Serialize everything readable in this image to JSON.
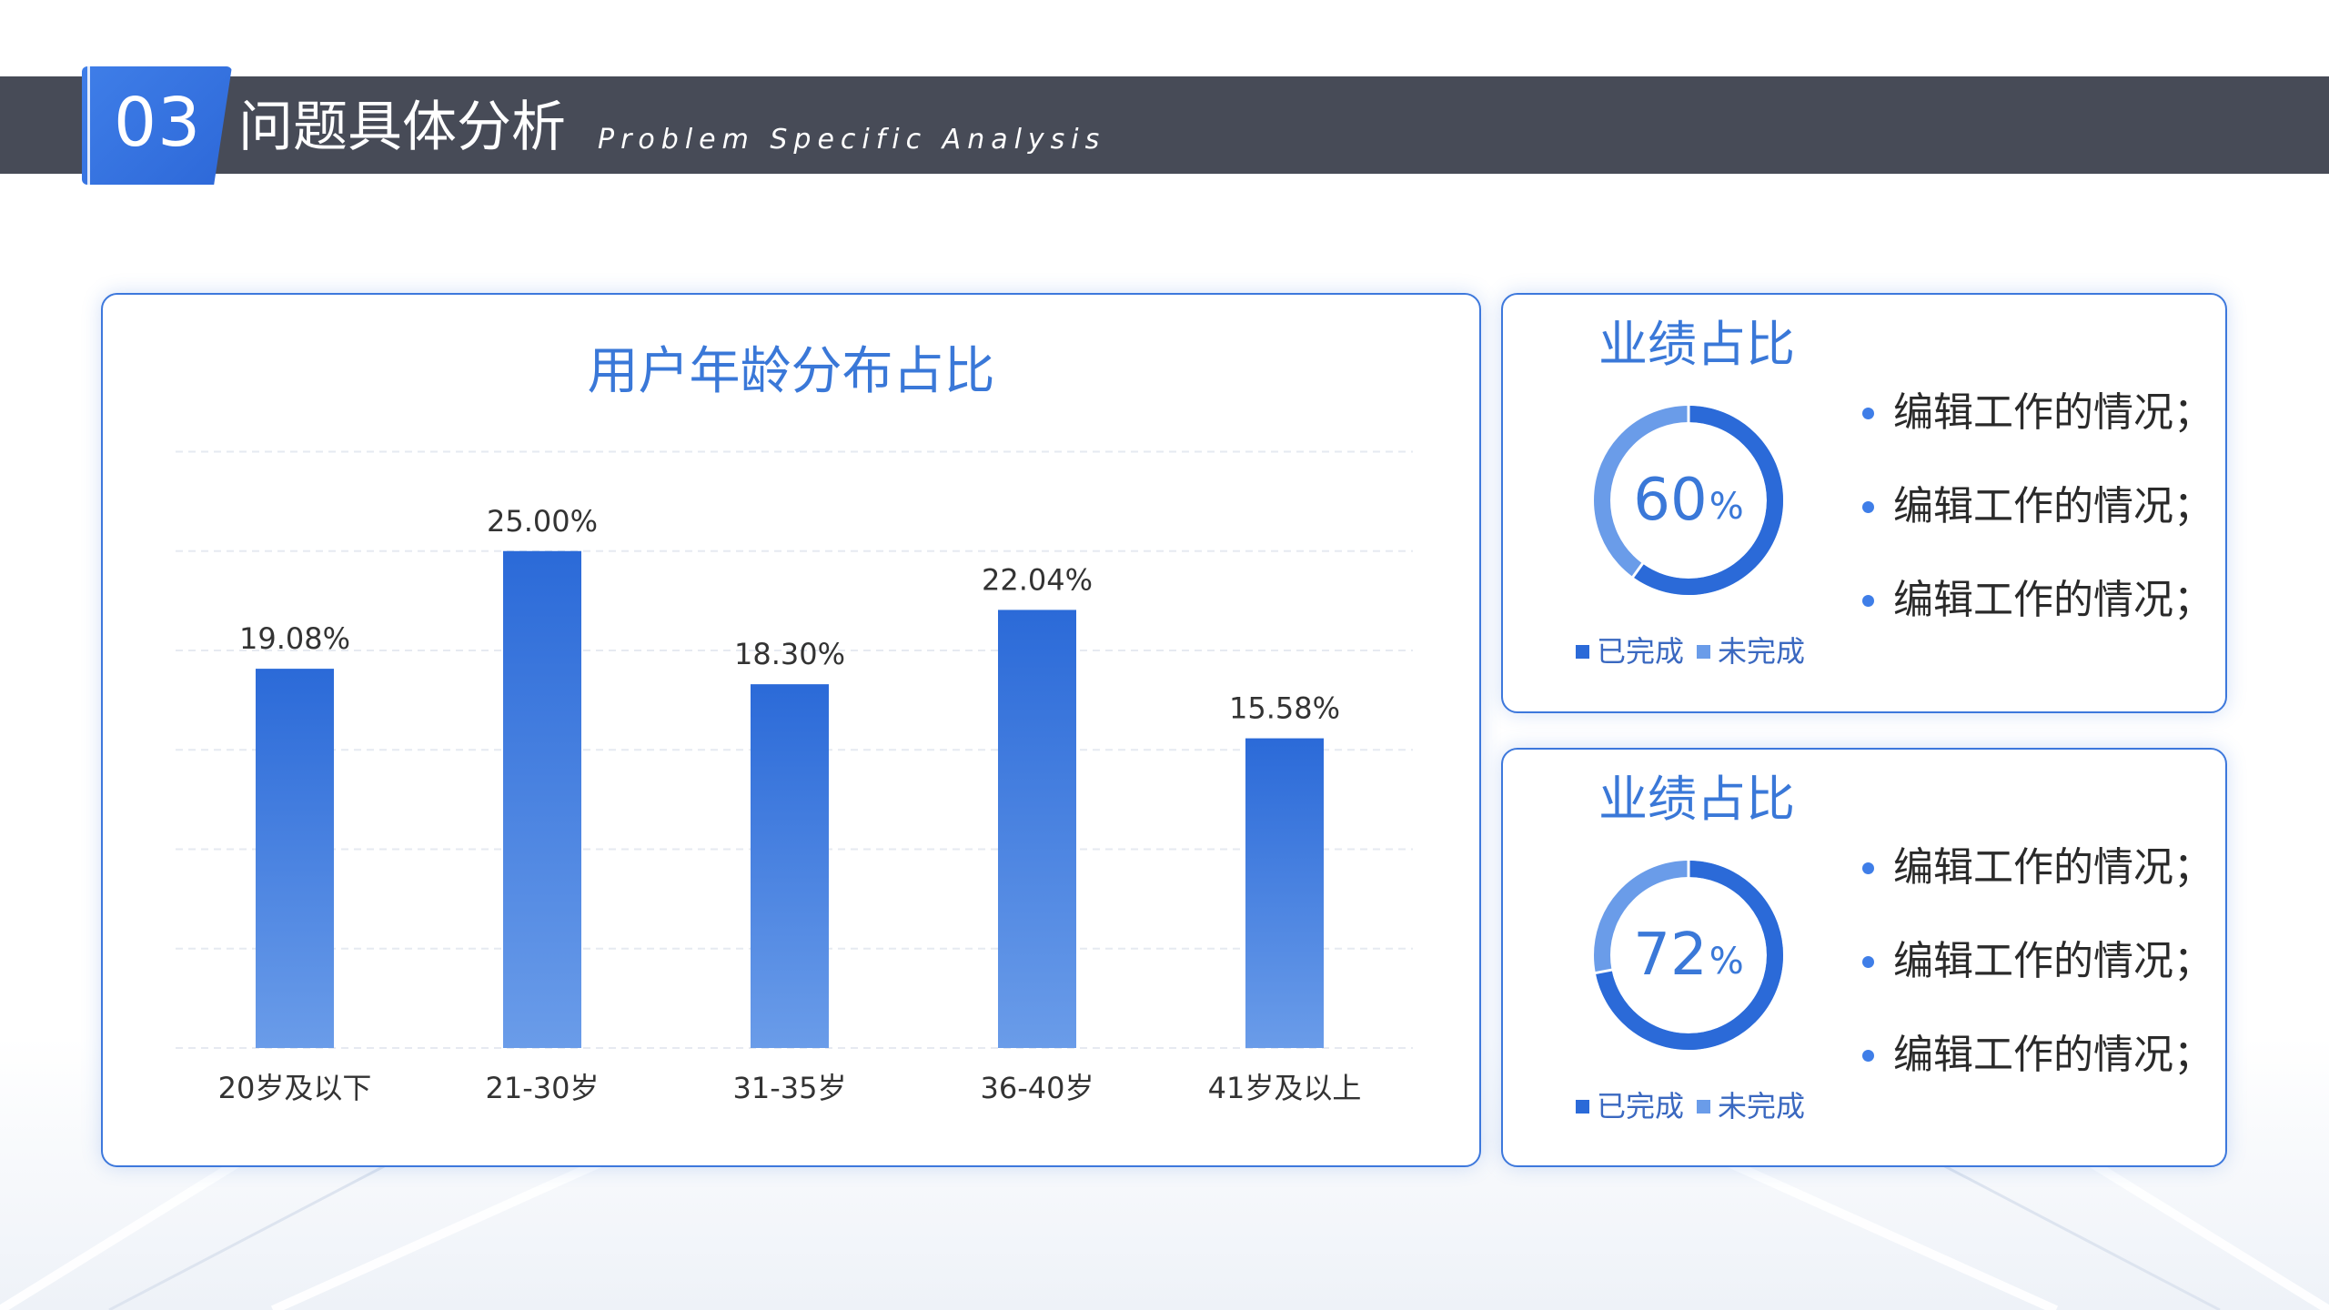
{
  "header": {
    "section_number": "03",
    "title": "问题具体分析",
    "subtitle": "Problem Specific Analysis"
  },
  "colors": {
    "header_bar": "#474b57",
    "accent": "#3a78d8",
    "bar_top": "#2b6ad8",
    "bar_bottom": "#6a9ce9",
    "donut_completed": "#2b6ad8",
    "donut_remaining": "#6a9ce9"
  },
  "chart_data": [
    {
      "type": "bar",
      "title": "用户年龄分布占比",
      "categories": [
        "20岁及以下",
        "21-30岁",
        "31-35岁",
        "36-40岁",
        "41岁及以上"
      ],
      "values": [
        19.08,
        25.0,
        18.3,
        22.04,
        15.58
      ],
      "value_labels": [
        "19.08%",
        "25.00%",
        "18.30%",
        "22.04%",
        "15.58%"
      ],
      "ylim": [
        0,
        30
      ],
      "grid": true,
      "xlabel": "",
      "ylabel": ""
    },
    {
      "type": "pie",
      "title": "业绩占比",
      "value": 60,
      "center_label": "60",
      "center_unit": "%",
      "categories": [
        "已完成",
        "未完成"
      ],
      "values": [
        60,
        40
      ]
    },
    {
      "type": "pie",
      "title": "业绩占比",
      "value": 72,
      "center_label": "72",
      "center_unit": "%",
      "categories": [
        "已完成",
        "未完成"
      ],
      "values": [
        72,
        28
      ]
    }
  ],
  "panels": [
    {
      "title": "业绩占比",
      "bullets": [
        "编辑工作的情况；",
        "编辑工作的情况；",
        "编辑工作的情况；"
      ],
      "legend": [
        "已完成",
        "未完成"
      ]
    },
    {
      "title": "业绩占比",
      "bullets": [
        "编辑工作的情况；",
        "编辑工作的情况；",
        "编辑工作的情况；"
      ],
      "legend": [
        "已完成",
        "未完成"
      ]
    }
  ]
}
